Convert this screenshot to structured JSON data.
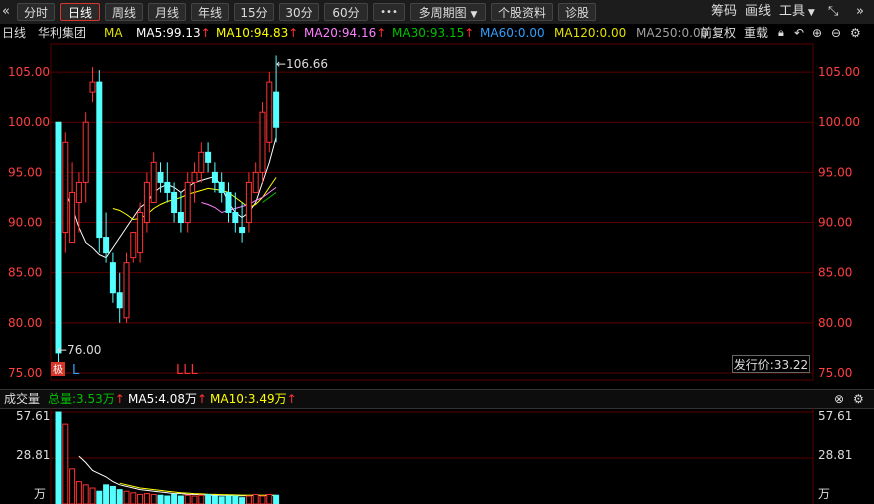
{
  "toolbar": {
    "nav_left": "«",
    "tabs": [
      "分时",
      "日线",
      "周线",
      "月线",
      "年线",
      "15分",
      "30分",
      "60分"
    ],
    "more": "•••",
    "multi_period": "多周期图",
    "stock_info": "个股资料",
    "diagnose": "诊股",
    "chips": "筹码",
    "draw": "画线",
    "tools": "工具",
    "nav_right": "»"
  },
  "ma_row": {
    "period": "日线",
    "stock_name": "华利集团",
    "ma_label": "MA",
    "ma5": "MA5:99.13",
    "ma10": "MA10:94.83",
    "ma20": "MA20:94.16",
    "ma30": "MA30:93.15",
    "ma60": "MA60:0.00",
    "ma120": "MA120:0.00",
    "ma250": "MA250:0.00",
    "adjust": "前复权",
    "reload": "重载",
    "up_arrow": "↑"
  },
  "colors": {
    "up": "#ff3232",
    "down": "#54ffff",
    "ma5": "#ffffff",
    "ma10": "#ffff00",
    "ma20": "#ff80ff",
    "ma30": "#00c000",
    "ma60": "#2f9fff",
    "ma120": "#e0e000",
    "ma250": "#a0a0a0",
    "grid": "#5a0000"
  },
  "price_axis": {
    "ticks": [
      "105.00",
      "100.00",
      "95.00",
      "90.00",
      "85.00",
      "80.00",
      "75.00"
    ],
    "max_label": "←106.66",
    "min_label": "←76.00",
    "markers": [
      "L",
      "LLL"
    ],
    "badge": "极",
    "issue_price": "发行价:33.22"
  },
  "chart_data": {
    "type": "candlestick",
    "ylim": [
      74.3,
      107.8
    ],
    "candles": [
      {
        "o": 100,
        "h": 100,
        "l": 76,
        "c": 77
      },
      {
        "o": 89,
        "h": 99,
        "l": 87,
        "c": 98
      },
      {
        "o": 88,
        "h": 96,
        "l": 88,
        "c": 93
      },
      {
        "o": 92,
        "h": 95,
        "l": 89,
        "c": 94
      },
      {
        "o": 94,
        "h": 101,
        "l": 92,
        "c": 100
      },
      {
        "o": 103,
        "h": 105.5,
        "l": 102,
        "c": 104
      },
      {
        "o": 104,
        "h": 105.2,
        "l": 87,
        "c": 88.5
      },
      {
        "o": 88.5,
        "h": 91,
        "l": 86,
        "c": 87
      },
      {
        "o": 86,
        "h": 87,
        "l": 82,
        "c": 83
      },
      {
        "o": 83,
        "h": 85,
        "l": 80,
        "c": 81.5
      },
      {
        "o": 80.5,
        "h": 87,
        "l": 80,
        "c": 86
      },
      {
        "o": 86.5,
        "h": 89,
        "l": 86,
        "c": 89
      },
      {
        "o": 87,
        "h": 92,
        "l": 86,
        "c": 91
      },
      {
        "o": 90,
        "h": 95,
        "l": 89,
        "c": 94
      },
      {
        "o": 92,
        "h": 97,
        "l": 92,
        "c": 96
      },
      {
        "o": 95,
        "h": 96,
        "l": 93,
        "c": 94
      },
      {
        "o": 94,
        "h": 96,
        "l": 92,
        "c": 93
      },
      {
        "o": 93,
        "h": 94,
        "l": 90,
        "c": 91
      },
      {
        "o": 91,
        "h": 93,
        "l": 89,
        "c": 90
      },
      {
        "o": 90,
        "h": 95,
        "l": 89,
        "c": 94
      },
      {
        "o": 94,
        "h": 96,
        "l": 92,
        "c": 95
      },
      {
        "o": 95,
        "h": 98,
        "l": 94,
        "c": 97
      },
      {
        "o": 97,
        "h": 98,
        "l": 95,
        "c": 96
      },
      {
        "o": 95,
        "h": 96,
        "l": 93,
        "c": 94
      },
      {
        "o": 94,
        "h": 95,
        "l": 92,
        "c": 93
      },
      {
        "o": 93,
        "h": 94,
        "l": 90,
        "c": 91
      },
      {
        "o": 91,
        "h": 93,
        "l": 89,
        "c": 90
      },
      {
        "o": 89.5,
        "h": 92,
        "l": 88,
        "c": 89
      },
      {
        "o": 90,
        "h": 95,
        "l": 89,
        "c": 94
      },
      {
        "o": 93,
        "h": 96,
        "l": 93,
        "c": 95
      },
      {
        "o": 95,
        "h": 102,
        "l": 94,
        "c": 101
      },
      {
        "o": 98,
        "h": 105,
        "l": 97,
        "c": 104
      },
      {
        "o": 103,
        "h": 106.66,
        "l": 98,
        "c": 99.5
      }
    ],
    "ma5": [
      93,
      91.5,
      89.5,
      88,
      87.5,
      86.8,
      86.5,
      87.5,
      88.5,
      89.5,
      90.5,
      91.5,
      92,
      93,
      93.5,
      93.8,
      93.5,
      93,
      93.5,
      94,
      94.2,
      94.4,
      94.6,
      93.5,
      92,
      91,
      90.5,
      91,
      92,
      94,
      96,
      98.5
    ],
    "ma10": [
      91.4,
      91.2,
      90.8,
      90.3,
      90.4,
      90.8,
      91.4,
      91.8,
      92.1,
      92.3,
      92.5,
      92.8,
      93.0,
      93.2,
      93.4,
      93.3,
      93.2,
      93.0,
      92.5,
      92.0,
      91.5,
      91.8,
      92.5,
      93.5,
      94.5
    ],
    "ma20": [
      92.0,
      91.8,
      91.5,
      91.0,
      91.2,
      91.4,
      91.6,
      91.8,
      92.2,
      92.5,
      93.0,
      93.5
    ],
    "ma30": [
      92.0,
      92.5,
      93.0
    ],
    "vol_ylim": [
      0,
      57.61
    ],
    "volumes": [
      57.61,
      50,
      22,
      14,
      12,
      10,
      8,
      12,
      11,
      9,
      8,
      7,
      6,
      6.5,
      6,
      5.5,
      5,
      6,
      5,
      5.5,
      5,
      5.5,
      6,
      5,
      4.5,
      5,
      5,
      4,
      5,
      6,
      5,
      6,
      5.5
    ],
    "vol_ma5": [
      30,
      26,
      21,
      19,
      17,
      14,
      12,
      11,
      10,
      9,
      8.5,
      8,
      7.5,
      7,
      6.5,
      6.5,
      6,
      6,
      5.8,
      5.6,
      5.6,
      5.5,
      5.4,
      5.2,
      5.2,
      5.3,
      5.4,
      5.4,
      5.5,
      5.4
    ],
    "vol_ma10": [
      13,
      12,
      11,
      10,
      9.5,
      9,
      8.5,
      8,
      7.5,
      7,
      6.8,
      6.5,
      6.3,
      6.1,
      6,
      5.9,
      5.8,
      5.7,
      5.6,
      5.6,
      5.5,
      5.5,
      5.5,
      5.4
    ]
  },
  "vol_row": {
    "title": "成交量",
    "total": "总量:3.53万",
    "ma5": "MA5:4.08万",
    "ma10": "MA10:3.49万",
    "up_arrow": "↑"
  },
  "vol_axis": {
    "ticks": [
      "57.61",
      "28.81"
    ],
    "unit": "万"
  }
}
